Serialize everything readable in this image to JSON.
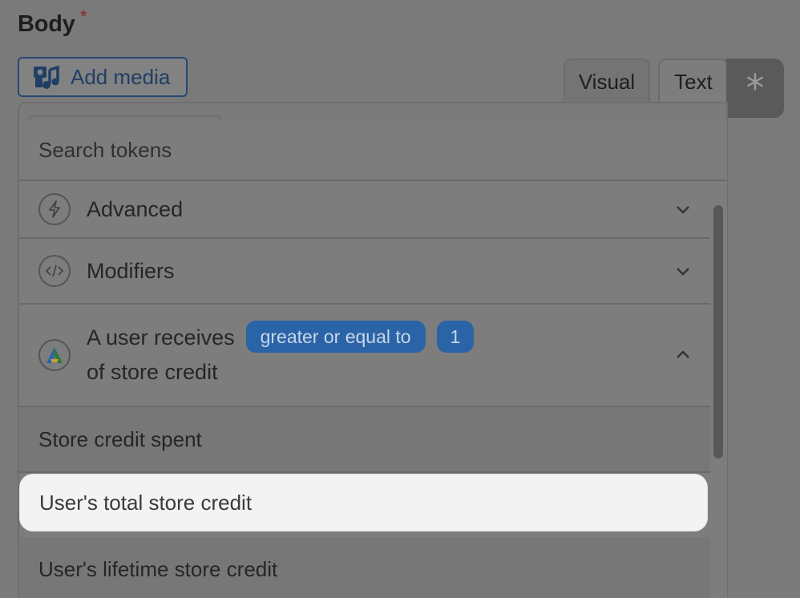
{
  "field": {
    "label": "Body",
    "required_mark": "*"
  },
  "toolbar": {
    "add_media_label": "Add media",
    "tabs": [
      {
        "label": "Visual"
      },
      {
        "label": "Text"
      }
    ],
    "token_button_label": "*"
  },
  "dropdown": {
    "search_placeholder": "Search tokens",
    "groups": [
      {
        "label": "Advanced",
        "icon": "bolt-icon",
        "expanded": false
      },
      {
        "label": "Modifiers",
        "icon": "code-icon",
        "expanded": false
      }
    ],
    "trigger": {
      "text_before": "A user receives",
      "operator": "greater or equal to",
      "value": "1",
      "text_after": "of store credit",
      "icon": "app-logo-icon",
      "expanded": true
    },
    "items": [
      {
        "label": "Store credit spent"
      },
      {
        "label": "User's total store credit",
        "highlighted": true
      },
      {
        "label": "User's lifetime store credit"
      }
    ]
  },
  "colors": {
    "overlay": "#7a7a7a",
    "accent": "#2b64a6",
    "highlight": "#f3f3f3"
  }
}
